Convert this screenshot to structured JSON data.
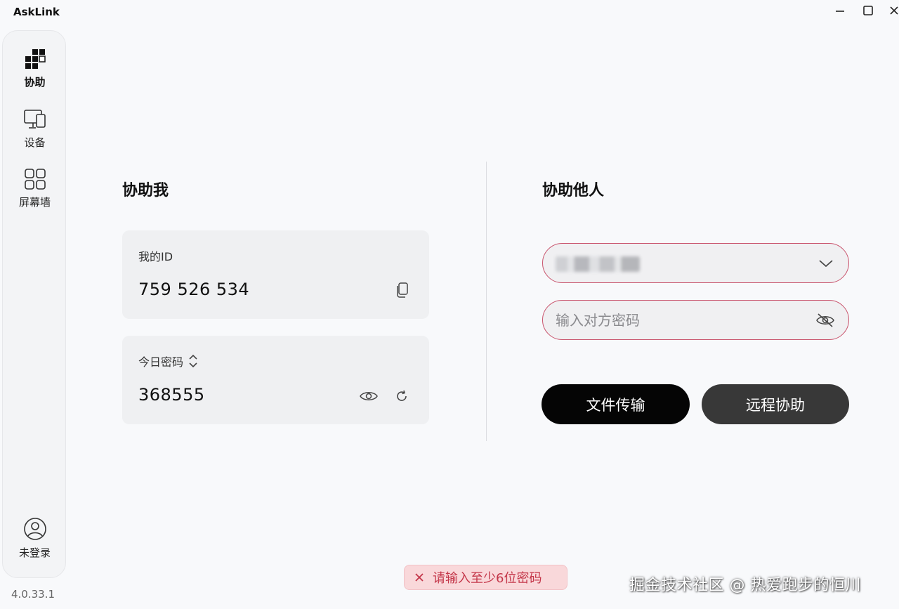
{
  "app": {
    "title": "AskLink",
    "version": "4.0.33.1"
  },
  "sidebar": {
    "items": [
      {
        "label": "协助",
        "icon": "assist-logo-icon",
        "active": true
      },
      {
        "label": "设备",
        "icon": "devices-icon"
      },
      {
        "label": "屏幕墙",
        "icon": "grid-icon"
      }
    ],
    "login": {
      "label": "未登录",
      "icon": "user-avatar-icon"
    }
  },
  "assist_me": {
    "title": "协助我",
    "id_card": {
      "label": "我的ID",
      "value": "759 526 534"
    },
    "password_card": {
      "label": "今日密码",
      "value": "368555"
    }
  },
  "assist_others": {
    "title": "协助他人",
    "partner_id": {
      "value": "",
      "obscured": true
    },
    "password": {
      "placeholder": "输入对方密码",
      "value": ""
    },
    "buttons": {
      "file_transfer": "文件传输",
      "remote_assist": "远程协助"
    }
  },
  "toast": {
    "message": "请输入至少6位密码",
    "type": "error"
  },
  "watermark": "掘金技术社区 @ 热爱跑步的恒川",
  "colors": {
    "background": "#f8f9fb",
    "error_border": "#c9546d",
    "toast_bg": "#f9d8da",
    "toast_text": "#c4374a",
    "primary_button": "#050505",
    "secondary_button": "#383838"
  }
}
